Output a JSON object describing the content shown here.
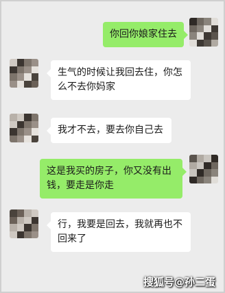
{
  "colors": {
    "background": "#ececec",
    "outgoing_bubble": "#95ec69",
    "incoming_bubble": "#ffffff"
  },
  "messages": [
    {
      "side": "out",
      "text": "你回你娘家住去"
    },
    {
      "side": "in",
      "text": "生气的时候让我回去住，你怎么不去你妈家"
    },
    {
      "side": "in",
      "text": "我才不去，要去你自己去"
    },
    {
      "side": "out",
      "text": "这是我买的房子，你又没有出钱，要走是你走"
    },
    {
      "side": "in",
      "text": "行，我要是回去，我就再也不回来了"
    }
  ],
  "watermark": {
    "text": "搜狐号@孙二蛋"
  }
}
